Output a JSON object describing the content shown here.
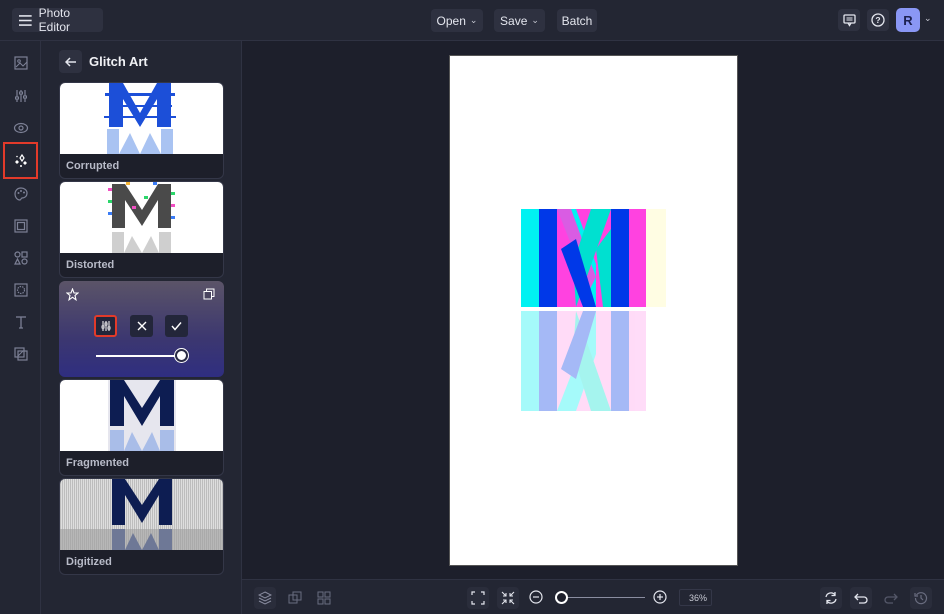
{
  "app": {
    "title": "Photo Editor"
  },
  "topbar": {
    "open_label": "Open",
    "save_label": "Save",
    "batch_label": "Batch",
    "avatar_initial": "R"
  },
  "rail": {
    "items": [
      {
        "name": "image",
        "active": false
      },
      {
        "name": "adjustments",
        "active": false
      },
      {
        "name": "eye",
        "active": false
      },
      {
        "name": "effects",
        "active": true
      },
      {
        "name": "artsy",
        "active": false
      },
      {
        "name": "frames",
        "active": false
      },
      {
        "name": "graphics",
        "active": false
      },
      {
        "name": "overlays",
        "active": false
      },
      {
        "name": "text",
        "active": false
      },
      {
        "name": "textures",
        "active": false
      }
    ]
  },
  "panel": {
    "title": "Glitch Art",
    "effects": [
      {
        "label": "Corrupted"
      },
      {
        "label": "Distorted"
      },
      {
        "label": "",
        "active": true,
        "intensity": 1.0
      },
      {
        "label": "Fragmented"
      },
      {
        "label": "Digitized"
      }
    ]
  },
  "canvas": {
    "zoom_label": "36%",
    "zoom_fraction": 0.0
  },
  "colors": {
    "accent": "#8a97f5",
    "highlight": "#e23a2a",
    "bg": "#1d1f2b"
  }
}
